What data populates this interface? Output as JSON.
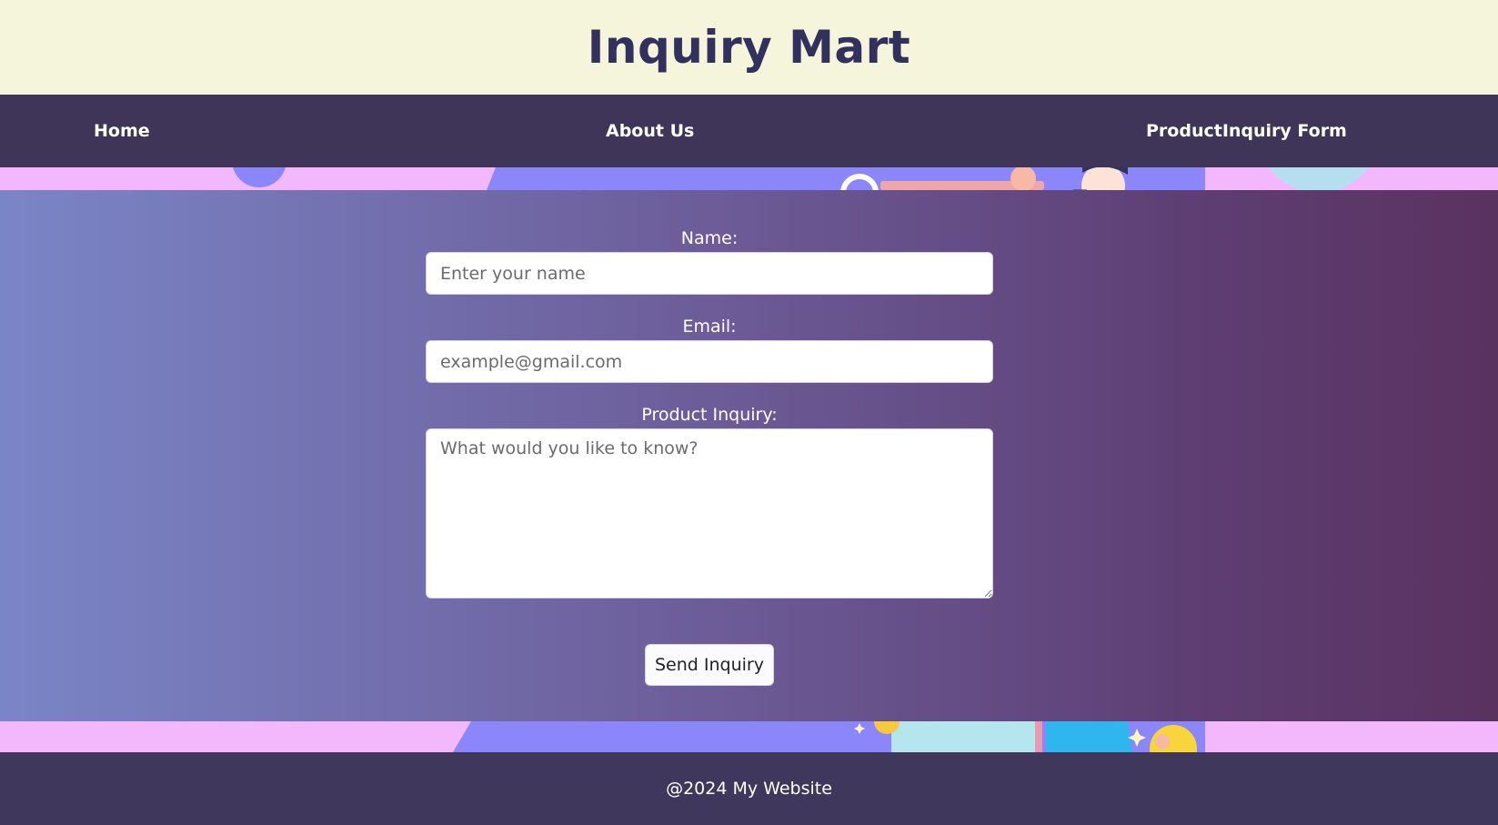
{
  "header": {
    "title": "Inquiry Mart"
  },
  "nav": {
    "items": [
      {
        "label": "Home"
      },
      {
        "label": "About Us"
      },
      {
        "label": "ProductInquiry Form"
      }
    ]
  },
  "form": {
    "name": {
      "label": "Name:",
      "placeholder": "Enter your name",
      "value": ""
    },
    "email": {
      "label": "Email:",
      "placeholder": "example@gmail.com",
      "value": ""
    },
    "inquiry": {
      "label": "Product Inquiry:",
      "placeholder": "What would you like to know?",
      "value": ""
    },
    "submit_label": "Send Inquiry"
  },
  "footer": {
    "text": "@2024 My Website"
  },
  "colors": {
    "header_bg": "#f5f5dc",
    "nav_bg": "#3f3559",
    "banner_pink": "#f3b7fb",
    "banner_purple": "#8c86fb",
    "gradient_start": "#7a85c7",
    "gradient_end": "#5a3260"
  },
  "decorations": {
    "banner_illustration": "shopping-illustration"
  }
}
